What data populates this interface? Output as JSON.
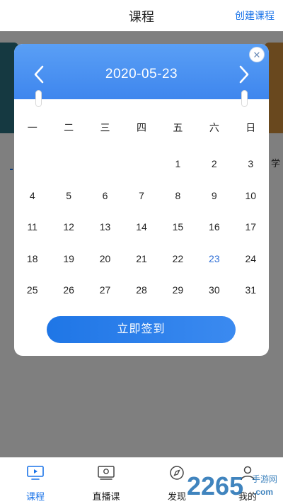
{
  "header": {
    "title": "课程",
    "action_label": "创建课程"
  },
  "background": {
    "side_text": "学"
  },
  "calendar": {
    "title": "2020-05-23",
    "weekdays": [
      "一",
      "二",
      "三",
      "四",
      "五",
      "六",
      "日"
    ],
    "weeks": [
      [
        "",
        "",
        "",
        "",
        "1",
        "2",
        "3"
      ],
      [
        "4",
        "5",
        "6",
        "7",
        "8",
        "9",
        "10"
      ],
      [
        "11",
        "12",
        "13",
        "14",
        "15",
        "16",
        "17"
      ],
      [
        "18",
        "19",
        "20",
        "21",
        "22",
        "23",
        "24"
      ],
      [
        "25",
        "26",
        "27",
        "28",
        "29",
        "30",
        "31"
      ]
    ],
    "selected_day": "23",
    "sign_label": "立即签到",
    "close_glyph": "✕"
  },
  "tabs": [
    {
      "label": "课程",
      "icon": "course-tv-icon",
      "active": true
    },
    {
      "label": "直播课",
      "icon": "live-class-icon",
      "active": false
    },
    {
      "label": "发现",
      "icon": "discover-icon",
      "active": false
    },
    {
      "label": "我的",
      "icon": "profile-icon",
      "active": false
    }
  ],
  "watermark": {
    "text": "2265",
    "sub": "手游网",
    "domain": ".com"
  },
  "colors": {
    "accent": "#1a73e8",
    "header_gradient_top": "#5a9ff5",
    "header_gradient_bottom": "#3e86ee",
    "today": "#2f6fd6"
  }
}
